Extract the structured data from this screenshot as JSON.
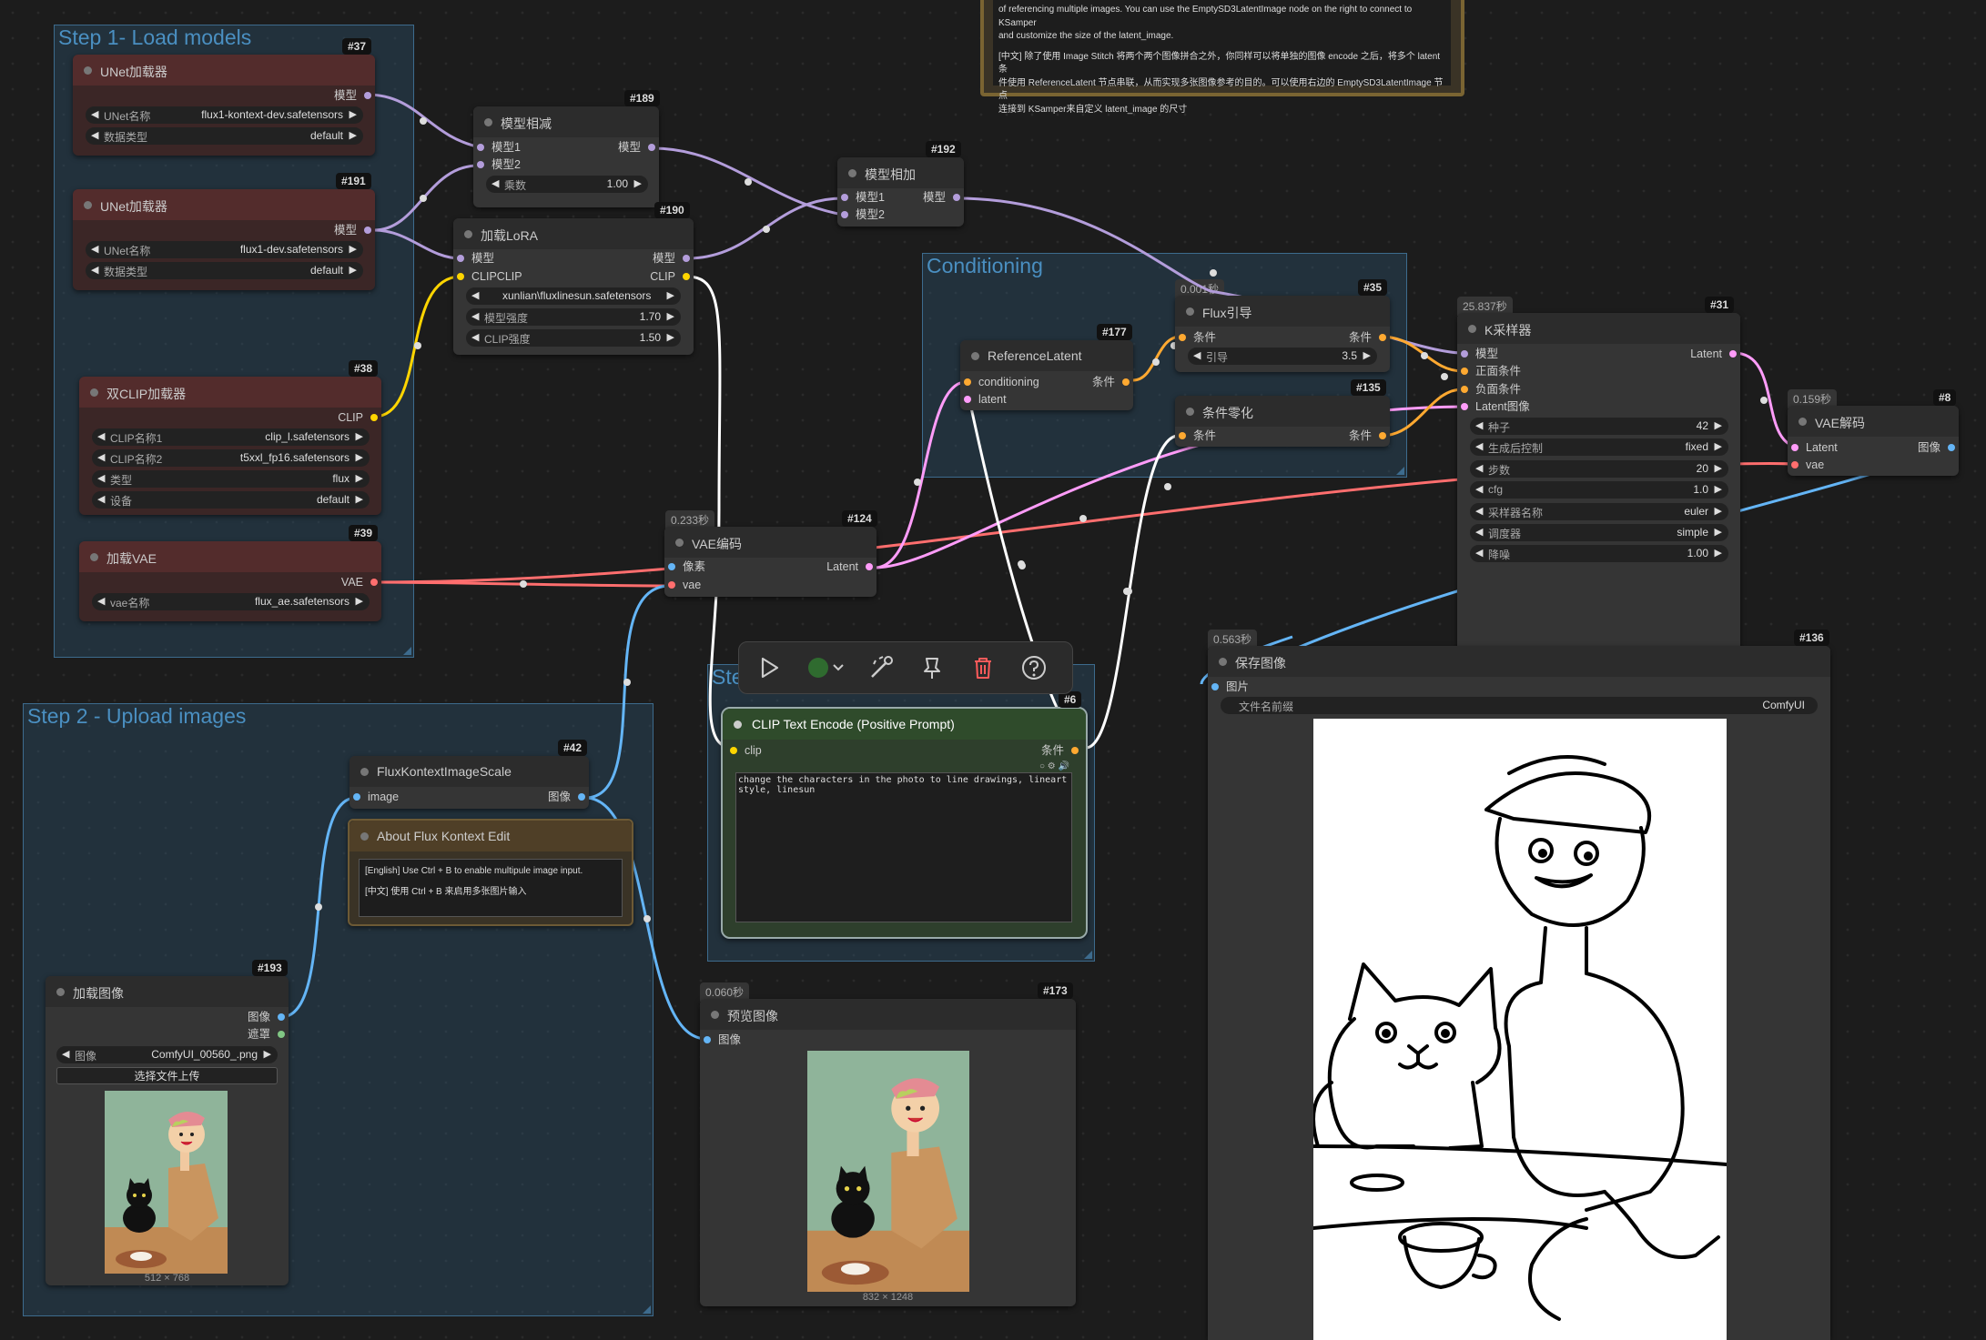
{
  "groups": {
    "step1": "Step 1- Load models",
    "step2": "Step 2 - Upload images",
    "step3": "Ste",
    "conditioning": "Conditioning"
  },
  "nodes": {
    "n37": {
      "id": "#37",
      "title": "UNet加载器",
      "out": "模型",
      "w1_label": "UNet名称",
      "w1_value": "flux1-kontext-dev.safetensors",
      "w2_label": "数据类型",
      "w2_value": "default"
    },
    "n191": {
      "id": "#191",
      "title": "UNet加载器",
      "out": "模型",
      "w1_label": "UNet名称",
      "w1_value": "flux1-dev.safetensors",
      "w2_label": "数据类型",
      "w2_value": "default"
    },
    "n38": {
      "id": "#38",
      "title": "双CLIP加载器",
      "out": "CLIP",
      "w1_label": "CLIP名称1",
      "w1_value": "clip_l.safetensors",
      "w2_label": "CLIP名称2",
      "w2_value": "t5xxl_fp16.safetensors",
      "w3_label": "类型",
      "w3_value": "flux",
      "w4_label": "设备",
      "w4_value": "default"
    },
    "n39": {
      "id": "#39",
      "title": "加载VAE",
      "out": "VAE",
      "w1_label": "vae名称",
      "w1_value": "flux_ae.safetensors"
    },
    "n189": {
      "id": "#189",
      "title": "模型相减",
      "in1": "模型1",
      "in2": "模型2",
      "out": "模型",
      "w1_label": "乘数",
      "w1_value": "1.00"
    },
    "n190": {
      "id": "#190",
      "title": "加载LoRA",
      "in1": "模型",
      "in2": "CLIPCLIP",
      "out1": "模型",
      "out2": "CLIP",
      "w1_value": "xunlian\\fluxlinesun.safetensors",
      "w2_label": "模型强度",
      "w2_value": "1.70",
      "w3_label": "CLIP强度",
      "w3_value": "1.50"
    },
    "n192": {
      "id": "#192",
      "title": "模型相加",
      "in1": "模型1",
      "in2": "模型2",
      "out": "模型"
    },
    "n124": {
      "id": "#124",
      "time": "0.233秒",
      "title": "VAE编码",
      "in1": "像素",
      "in2": "vae",
      "out": "Latent"
    },
    "n177": {
      "id": "#177",
      "title": "ReferenceLatent",
      "in1": "conditioning",
      "in2": "latent",
      "out": "条件"
    },
    "n35": {
      "id": "#35",
      "time": "0.001秒",
      "title": "Flux引导",
      "in": "条件",
      "out": "条件",
      "w1_label": "引导",
      "w1_value": "3.5"
    },
    "n135": {
      "id": "#135",
      "title": "条件零化",
      "in": "条件",
      "out": "条件"
    },
    "n31": {
      "id": "#31",
      "time": "25.837秒",
      "title": "K采样器",
      "in1": "模型",
      "in2": "正面条件",
      "in3": "负面条件",
      "in4": "Latent图像",
      "out": "Latent",
      "widgets": [
        {
          "label": "种子",
          "value": "42"
        },
        {
          "label": "生成后控制",
          "value": "fixed"
        },
        {
          "label": "步数",
          "value": "20"
        },
        {
          "label": "cfg",
          "value": "1.0"
        },
        {
          "label": "采样器名称",
          "value": "euler"
        },
        {
          "label": "调度器",
          "value": "simple"
        },
        {
          "label": "降噪",
          "value": "1.00"
        }
      ]
    },
    "n8": {
      "id": "#8",
      "time": "0.159秒",
      "title": "VAE解码",
      "in1": "Latent",
      "in2": "vae",
      "out": "图像"
    },
    "n42": {
      "id": "#42",
      "title": "FluxKontextImageScale",
      "in": "image",
      "out": "图像"
    },
    "note": {
      "title": "About Flux Kontext Edit",
      "line1": "[English] Use Ctrl + B to enable multipule image input.",
      "line2": "[中文] 使用 Ctrl + B 来启用多张图片输入"
    },
    "topnote": {
      "line1": "of referencing multiple images. You can use the EmptySD3LatentImage node on the right to connect to KSamper",
      "line2": "and customize the size of the latent_image.",
      "line3": "[中文] 除了使用 Image Stitch 将两个两个图像拼合之外，你同样可以将单独的图像 encode 之后，将多个 latent 条",
      "line4": "件使用 ReferenceLatent 节点串联，从而实现多张图像参考的目的。可以使用右边的 EmptySD3LatentImage 节点",
      "line5": "连接到 KSamper来自定义 latent_image 的尺寸"
    },
    "n6": {
      "id": "#6",
      "title": "CLIP Text Encode (Positive Prompt)",
      "in": "clip",
      "out": "条件",
      "prompt": "change the characters in the photo to line drawings, lineart style, linesun"
    },
    "n193": {
      "id": "#193",
      "title": "加载图像",
      "out1": "图像",
      "out2": "遮罩",
      "w1_label": "图像",
      "w1_value": "ComfyUI_00560_.png",
      "upload": "选择文件上传",
      "size": "512 × 768"
    },
    "n173": {
      "id": "#173",
      "time": "0.060秒",
      "title": "预览图像",
      "in": "图像",
      "size": "832 × 1248"
    },
    "n136": {
      "id": "#136",
      "time": "0.563秒",
      "title": "保存图像",
      "in": "图片",
      "w1_label": "文件名前缀",
      "w1_value": "ComfyUI"
    }
  },
  "toolbar": {
    "items": [
      "play-icon",
      "color-swatch-icon",
      "bypass-wand-icon",
      "pin-icon",
      "delete-icon",
      "help-icon"
    ]
  },
  "colors": {
    "model": "#b39ddb",
    "clip": "#ffd500",
    "vae": "#ff6e6e",
    "latent": "#ff9cf9",
    "conditioning": "#ffa931",
    "image": "#64b5f6",
    "mask": "#81c784",
    "prompt": "#ffffff"
  }
}
